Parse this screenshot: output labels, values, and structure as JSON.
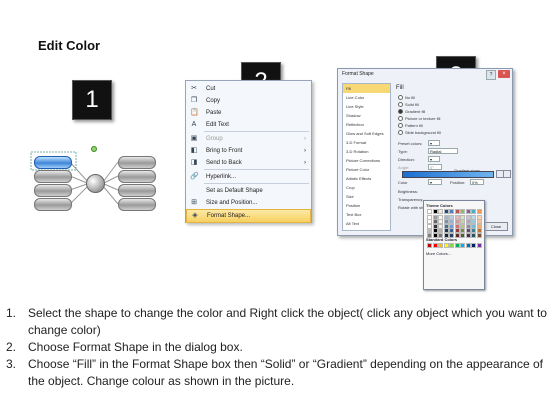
{
  "title": "Edit Color",
  "step_badges": [
    "1",
    "2",
    "3"
  ],
  "context_menu": {
    "items": [
      {
        "icon": "scissors-icon",
        "glyph": "✂",
        "label": "Cut",
        "arrow": "",
        "disabled": false,
        "highlight": false
      },
      {
        "icon": "copy-icon",
        "glyph": "❐",
        "label": "Copy",
        "arrow": "",
        "disabled": false,
        "highlight": false
      },
      {
        "icon": "paste-icon",
        "glyph": "📋",
        "label": "Paste",
        "arrow": "",
        "disabled": false,
        "highlight": false
      },
      {
        "icon": "edit-text-icon",
        "glyph": "A",
        "label": "Edit Text",
        "arrow": "",
        "disabled": false,
        "highlight": false
      },
      {
        "icon": "group-icon",
        "glyph": "▣",
        "label": "Group",
        "arrow": "›",
        "disabled": true,
        "highlight": false
      },
      {
        "icon": "bring-front-icon",
        "glyph": "◧",
        "label": "Bring to Front",
        "arrow": "›",
        "disabled": false,
        "highlight": false
      },
      {
        "icon": "send-back-icon",
        "glyph": "◨",
        "label": "Send to Back",
        "arrow": "›",
        "disabled": false,
        "highlight": false
      },
      {
        "icon": "hyperlink-icon",
        "glyph": "🔗",
        "label": "Hyperlink...",
        "arrow": "",
        "disabled": false,
        "highlight": false
      },
      {
        "icon": "",
        "glyph": "",
        "label": "Set as Default Shape",
        "arrow": "",
        "disabled": false,
        "highlight": false
      },
      {
        "icon": "size-position-icon",
        "glyph": "⊞",
        "label": "Size and Position...",
        "arrow": "",
        "disabled": false,
        "highlight": false
      },
      {
        "icon": "format-shape-icon",
        "glyph": "◈",
        "label": "Format Shape...",
        "arrow": "",
        "disabled": false,
        "highlight": true
      }
    ]
  },
  "dialog": {
    "title": "Format Shape",
    "close": "×",
    "help": "?",
    "sidebar": [
      "Fill",
      "Line Color",
      "Line Style",
      "Shadow",
      "Reflection",
      "Glow and Soft Edges",
      "3-D Format",
      "3-D Rotation",
      "Picture Corrections",
      "Picture Color",
      "Artistic Effects",
      "Crop",
      "Size",
      "Position",
      "Text Box",
      "Alt Text"
    ],
    "selected_sidebar": "Fill",
    "fill_heading": "Fill",
    "fill_options": [
      {
        "label": "No fill",
        "checked": false
      },
      {
        "label": "Solid fill",
        "checked": false
      },
      {
        "label": "Gradient fill",
        "checked": true
      },
      {
        "label": "Picture or texture fill",
        "checked": false
      },
      {
        "label": "Pattern fill",
        "checked": false
      },
      {
        "label": "Slide background fill",
        "checked": false
      }
    ],
    "preset_label": "Preset colors:",
    "type_label": "Type:",
    "type_value": "Radial",
    "direction_label": "Direction:",
    "angle_label": "Angle:",
    "angle_value": "0°",
    "stops_label": "Gradient stops",
    "color_label": "Color",
    "position_label": "Position:",
    "position_value": "0%",
    "brightness_label": "Brightness:",
    "transparency_label": "Transparency:",
    "rotate_label": "Rotate with shape",
    "theme_colors_label": "Theme Colors",
    "standard_colors_label": "Standard Colors",
    "more_colors_label": "More Colors...",
    "close_button": "Close",
    "theme_palette": [
      "#ffffff",
      "#000000",
      "#eeece1",
      "#1f497d",
      "#4f81bd",
      "#c0504d",
      "#9bbb59",
      "#8064a2",
      "#4bacc6",
      "#f79646"
    ],
    "standard_palette": [
      "#c00000",
      "#ff0000",
      "#ffc000",
      "#ffff00",
      "#92d050",
      "#00b050",
      "#00b0f0",
      "#0070c0",
      "#002060",
      "#7030a0"
    ]
  },
  "instructions": [
    {
      "num": "1.",
      "text": "Select the shape to change the color and Right click the object( click any object which you want to change color)"
    },
    {
      "num": "2.",
      "text": "Choose Format Shape in the dialog box."
    },
    {
      "num": "3.",
      "text": "Choose “Fill” in the Format Shape box then “Solid” or “Gradient” depending on the appearance of the object. Change colour as shown in the picture."
    }
  ]
}
